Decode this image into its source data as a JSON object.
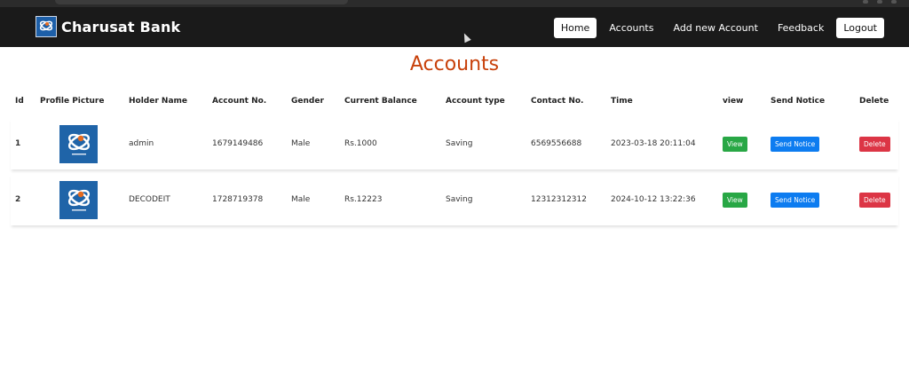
{
  "brand": {
    "name": "Charusat Bank"
  },
  "nav": {
    "items": [
      {
        "label": "Home",
        "active": true
      },
      {
        "label": "Accounts"
      },
      {
        "label": "Add new Account"
      },
      {
        "label": "Feedback"
      },
      {
        "label": "Logout"
      }
    ]
  },
  "page": {
    "title": "Accounts"
  },
  "table": {
    "headers": [
      "Id",
      "Profile Picture",
      "Holder Name",
      "Account No.",
      "Gender",
      "Current Balance",
      "Account type",
      "Contact No.",
      "Time",
      "view",
      "Send Notice",
      "Delete"
    ],
    "rows": [
      {
        "id": "1",
        "name": "admin",
        "account": "1679149486",
        "gender": "Male",
        "balance": "Rs.1000",
        "type": "Saving",
        "contact": "6569556688",
        "time": "2023-03-18 20:11:04",
        "view": "View",
        "notice": "Send Notice",
        "delete": "Delete"
      },
      {
        "id": "2",
        "name": "DECODEIT",
        "account": "1728719378",
        "gender": "Male",
        "balance": "Rs.12223",
        "type": "Saving",
        "contact": "12312312312",
        "time": "2024-10-12 13:22:36",
        "view": "View",
        "notice": "Send Notice",
        "delete": "Delete"
      }
    ]
  },
  "colors": {
    "navbar": "#1a1a1a",
    "title": "#c8410b",
    "view": "#28a745",
    "notice": "#0d7cf0",
    "delete": "#dc3545",
    "logo": "#1f64a8"
  },
  "icons": {
    "logo": "bank-logo-icon",
    "cursor": "mouse-cursor-icon"
  }
}
